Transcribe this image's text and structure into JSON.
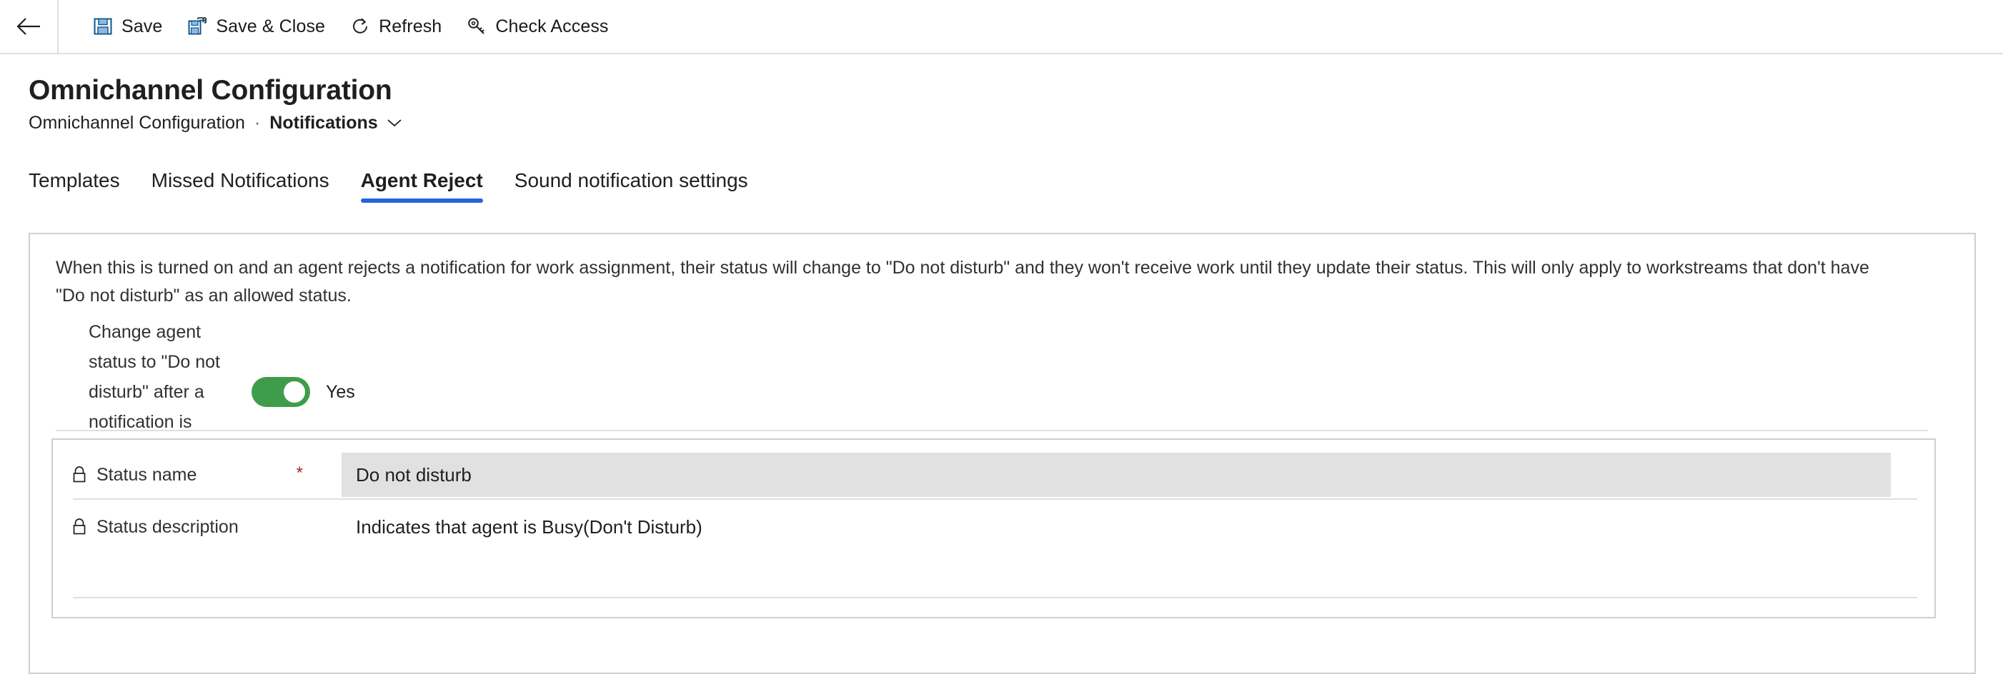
{
  "commandbar": {
    "back_icon": "arrow-left-icon",
    "items": [
      {
        "icon": "save-icon",
        "label": "Save"
      },
      {
        "icon": "save-and-close-icon",
        "label": "Save & Close"
      },
      {
        "icon": "refresh-icon",
        "label": "Refresh"
      },
      {
        "icon": "key-icon",
        "label": "Check Access"
      }
    ]
  },
  "header": {
    "title": "Omnichannel Configuration",
    "breadcrumb": {
      "entity": "Omnichannel Configuration",
      "separator": "·",
      "current": "Notifications",
      "chevron_icon": "chevron-down-icon"
    }
  },
  "tabs": [
    {
      "label": "Templates",
      "active": false
    },
    {
      "label": "Missed Notifications",
      "active": false
    },
    {
      "label": "Agent Reject",
      "active": true
    },
    {
      "label": "Sound notification settings",
      "active": false
    }
  ],
  "panel": {
    "intro": "When this is turned on and an agent rejects a notification for work assignment, their status will change to \"Do not disturb\" and they won't receive work until they update their status. This will only apply to workstreams that don't have \"Do not disturb\" as an allowed status.",
    "toggle": {
      "label": "Change agent status to \"Do not disturb\" after a notification is rejected",
      "value_text": "Yes",
      "checked": true,
      "on_color": "#3f9c4a"
    },
    "fields": [
      {
        "lock_icon": "lock-icon",
        "label": "Status name",
        "required": true,
        "required_marker": "*",
        "value": "Do not disturb",
        "style": "input"
      },
      {
        "lock_icon": "lock-icon",
        "label": "Status description",
        "required": false,
        "required_marker": "",
        "value": "Indicates that agent is Busy(Don't Disturb)",
        "style": "text"
      }
    ]
  },
  "colors": {
    "accent": "#2266dd",
    "required": "#a4262c",
    "toggle_on": "#3f9c4a",
    "input_bg": "#e1e1e1",
    "border": "#d0cece",
    "rule": "#e1dfdd"
  }
}
